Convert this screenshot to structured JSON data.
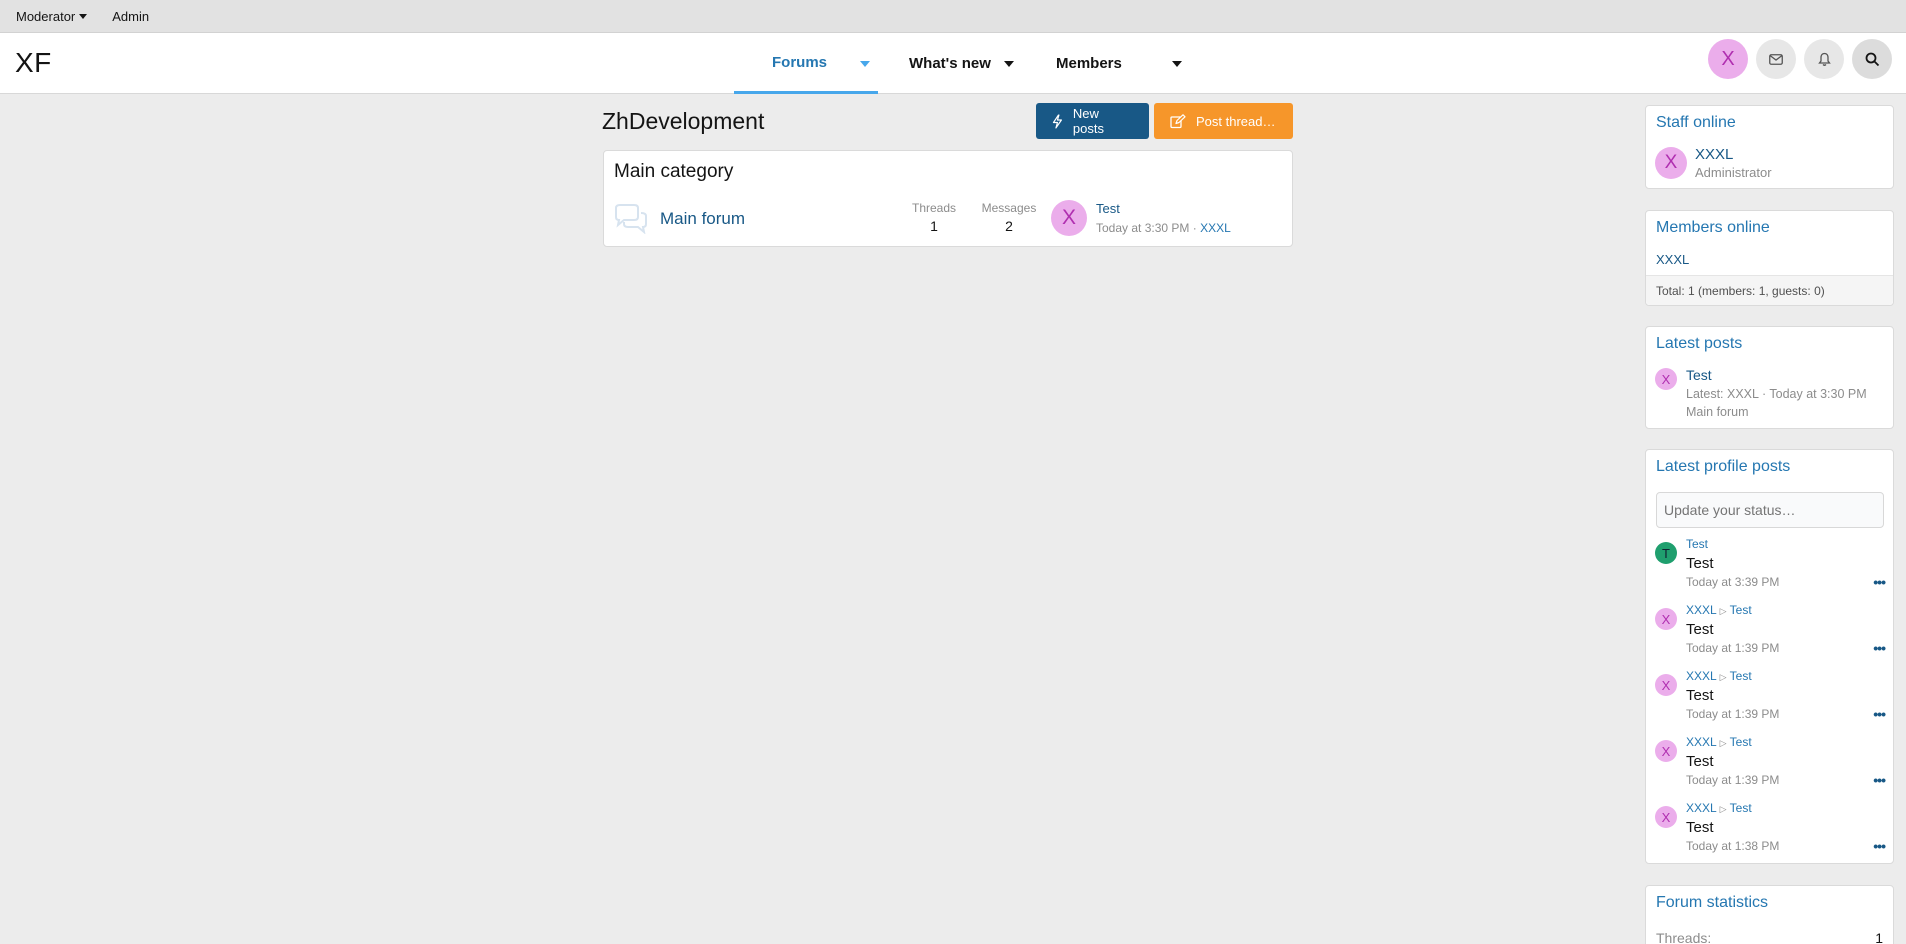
{
  "staffbar": {
    "moderator": "Moderator",
    "admin": "Admin"
  },
  "header": {
    "logo": "XF",
    "nav": {
      "forums": "Forums",
      "whats_new": "What's new",
      "members": "Members"
    },
    "avatar_letter": "X"
  },
  "main": {
    "title": "ZhDevelopment",
    "new_posts": "New posts",
    "post_thread": "Post thread…",
    "category": "Main category",
    "forum": {
      "title": "Main forum",
      "threads_label": "Threads",
      "threads": "1",
      "messages_label": "Messages",
      "messages": "2",
      "avatar_letter": "X",
      "last_title": "Test",
      "last_time": "Today at 3:30 PM",
      "last_sep": "·",
      "last_user": "XXXL"
    }
  },
  "sidebar": {
    "staff": {
      "title": "Staff online",
      "avatar_letter": "X",
      "name": "XXXL",
      "role": "Administrator"
    },
    "members": {
      "title": "Members online",
      "name": "XXXL",
      "total": "Total: 1 (members: 1, guests: 0)"
    },
    "latest": {
      "title": "Latest posts",
      "avatar_letter": "X",
      "thread": "Test",
      "meta": "Latest: XXXL · Today at 3:30 PM",
      "forum": "Main forum"
    },
    "profile": {
      "title": "Latest profile posts",
      "placeholder": "Update your status…",
      "posts": [
        {
          "avatar": "T",
          "from": "Test",
          "to": "",
          "body": "Test",
          "time": "Today at 3:39 PM"
        },
        {
          "avatar": "X",
          "from": "XXXL",
          "to": "Test",
          "body": "Test",
          "time": "Today at 1:39 PM"
        },
        {
          "avatar": "X",
          "from": "XXXL",
          "to": "Test",
          "body": "Test",
          "time": "Today at 1:39 PM"
        },
        {
          "avatar": "X",
          "from": "XXXL",
          "to": "Test",
          "body": "Test",
          "time": "Today at 1:39 PM"
        },
        {
          "avatar": "X",
          "from": "XXXL",
          "to": "Test",
          "body": "Test",
          "time": "Today at 1:38 PM"
        }
      ],
      "more": "•••"
    },
    "stats": {
      "title": "Forum statistics",
      "threads_label": "Threads:",
      "threads": "1"
    }
  },
  "colors": {
    "accent": "#2577b1",
    "nav_active": "#47a7eb",
    "new_posts_btn": "#185886",
    "post_thread_btn": "#f6962a",
    "avatar_bg": "#ebadeb",
    "avatar_fg": "#b02fb0",
    "avatar_green": "#1f9f6e"
  }
}
